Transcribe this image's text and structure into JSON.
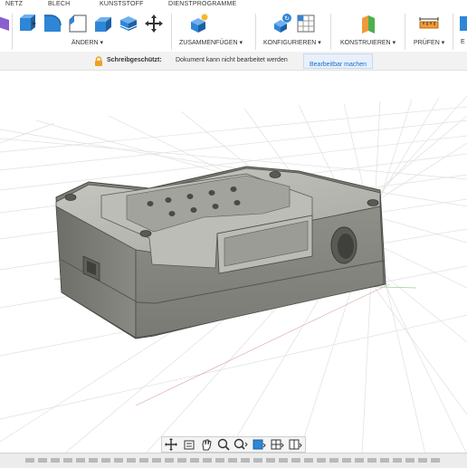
{
  "tabs": [
    "NETZ",
    "BLECH",
    "KUNSTSTOFF",
    "DIENSTPROGRAMME"
  ],
  "toolbar": {
    "aendern_label": "ÄNDERN",
    "zusammenfuegen_label": "ZUSAMMENFÜGEN",
    "konfigurieren_label": "KONFIGURIEREN",
    "konstruieren_label": "KONSTRUIEREN",
    "pruefen_label": "PRÜFEN",
    "truncated_label": "E",
    "dropdown_glyph": "▾"
  },
  "readonly_bar": {
    "title": "Schreibgeschützt:",
    "message": "Dokument kann nicht bearbeitet werden",
    "action_label": "Bearbeitbar machen"
  },
  "colors": {
    "accent": "#1a6fc9",
    "lock": "#f0a020",
    "ribbon_blue": "#2f86d6",
    "model_body": "#9b9b95",
    "grid_line": "#e0e0e0"
  },
  "navbar_icons": [
    "orbit-icon",
    "look-at-icon",
    "pan-icon",
    "zoom-icon",
    "zoom-window-icon",
    "display-settings-icon",
    "grid-settings-icon",
    "viewports-icon"
  ]
}
